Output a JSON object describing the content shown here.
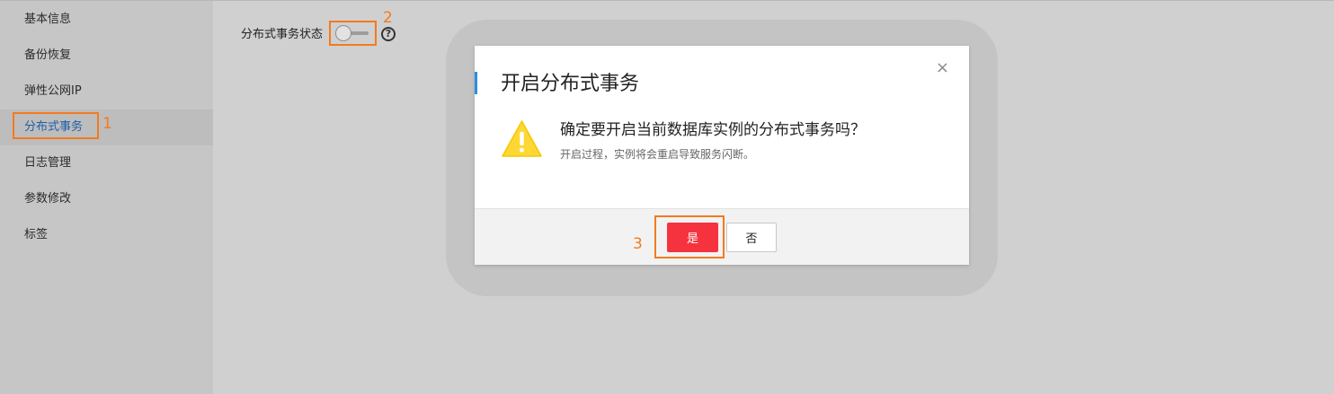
{
  "sidebar": {
    "items": [
      {
        "label": "基本信息",
        "active": false
      },
      {
        "label": "备份恢复",
        "active": false
      },
      {
        "label": "弹性公网IP",
        "active": false
      },
      {
        "label": "分布式事务",
        "active": true
      },
      {
        "label": "日志管理",
        "active": false
      },
      {
        "label": "参数修改",
        "active": false
      },
      {
        "label": "标签",
        "active": false
      }
    ]
  },
  "main": {
    "status_label": "分布式事务状态",
    "toggle_on": false,
    "help_icon": "question-circle-icon"
  },
  "annotations": [
    "1",
    "2",
    "3"
  ],
  "dialog": {
    "title": "开启分布式事务",
    "close_glyph": "×",
    "warning_icon": "warning-triangle-icon",
    "message": "确定要开启当前数据库实例的分布式事务吗？",
    "sub_message": "开启过程，实例将会重启导致服务闪断。",
    "yes_label": "是",
    "no_label": "否"
  },
  "colors": {
    "accent": "#2d8de6",
    "danger": "#f5333f",
    "annotation": "#f37a1f",
    "warning": "#fdd835"
  }
}
